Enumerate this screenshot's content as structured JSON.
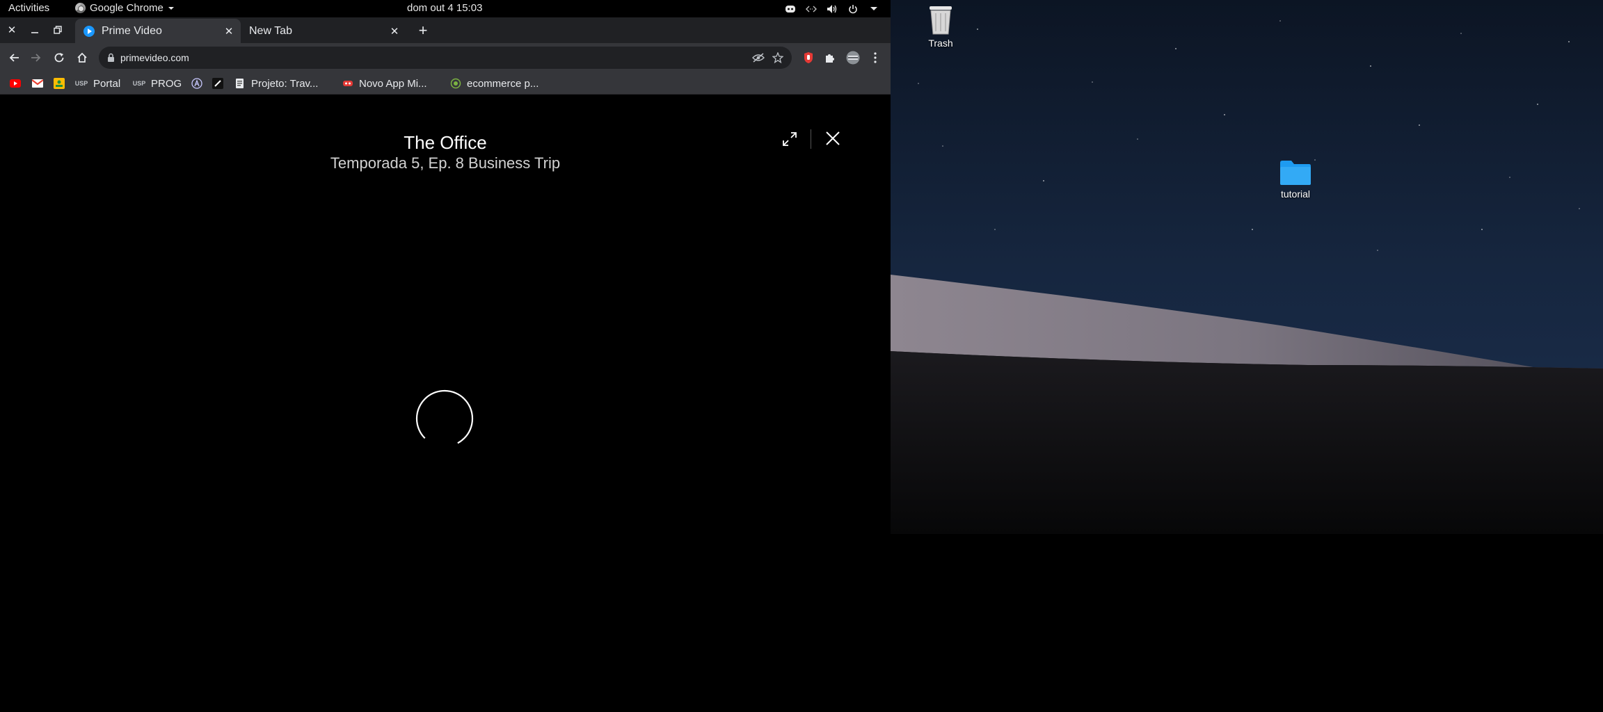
{
  "topbar": {
    "activities": "Activities",
    "app_name": "Google Chrome",
    "clock": "dom out 4  15:03",
    "tray_icons": [
      "discord-icon",
      "network-icon",
      "volume-icon",
      "power-icon",
      "chevron-down-icon"
    ]
  },
  "chrome": {
    "tabs": [
      {
        "title": "Prime Video",
        "active": true,
        "favicon": "prime-video-icon"
      },
      {
        "title": "New Tab",
        "active": false
      }
    ],
    "url": "primevideo.com",
    "bookmarks": [
      {
        "label": "",
        "icon": "youtube-icon",
        "color": "#ff0000"
      },
      {
        "label": "",
        "icon": "gmail-icon",
        "color": "#ea4335"
      },
      {
        "label": "",
        "icon": "photos-icon",
        "color": "#fbbc04"
      },
      {
        "label": "Portal",
        "icon": "usp-icon",
        "color": "#bdc1c6"
      },
      {
        "label": "PROG",
        "icon": "usp-icon",
        "color": "#bdc1c6"
      },
      {
        "label": "",
        "icon": "a-icon",
        "color": "#c8c8ff"
      },
      {
        "label": "",
        "icon": "notion-icon",
        "color": "#ffffff"
      },
      {
        "label": "Projeto: Trav...",
        "icon": "doc-icon",
        "color": "#e8eaed"
      },
      {
        "label": "Novo App Mi...",
        "icon": "app-icon",
        "color": "#e53935"
      },
      {
        "label": "ecommerce p...",
        "icon": "figma-icon",
        "color": "#7cb342"
      }
    ]
  },
  "player": {
    "show_title": "The Office",
    "episode_title": "Temporada 5, Ep. 8 Business Trip",
    "loading": true
  },
  "desktop": {
    "icons": [
      {
        "label": "Trash",
        "icon": "trash-icon"
      },
      {
        "label": "tutorial",
        "icon": "folder-icon",
        "color": "#1e9bf0"
      }
    ]
  }
}
